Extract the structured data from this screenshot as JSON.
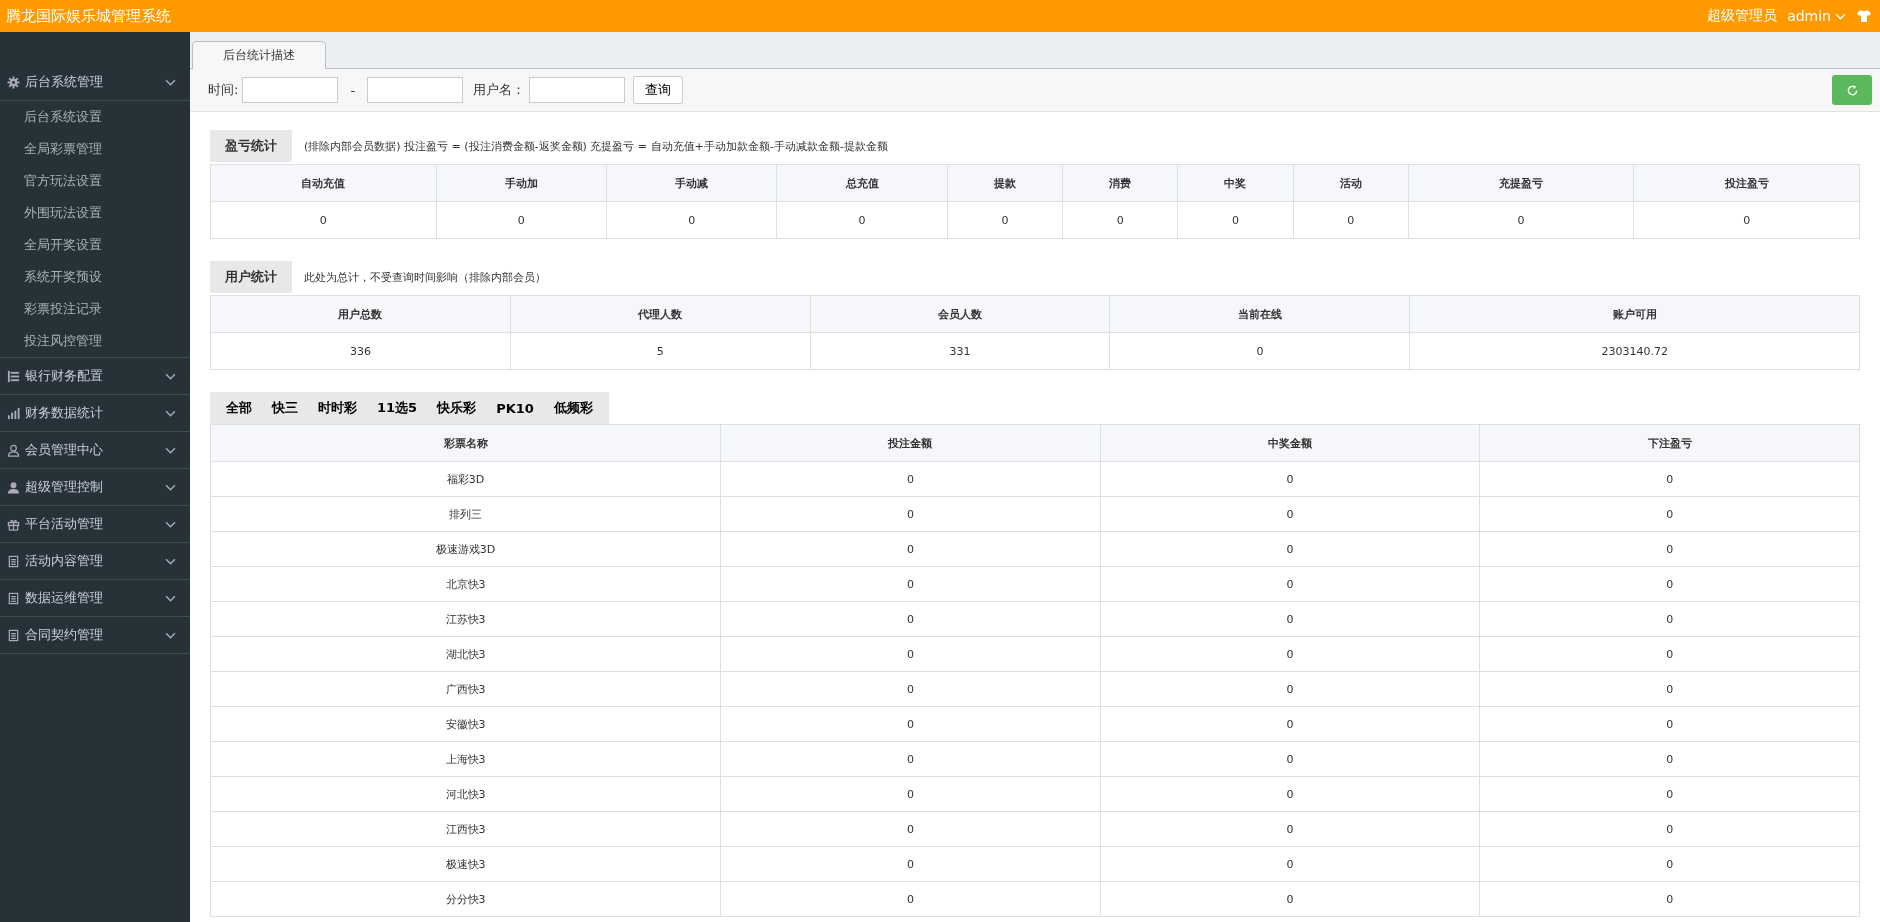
{
  "header": {
    "title": "腾龙国际娱乐城管理系统",
    "role": "超级管理员",
    "user": "admin"
  },
  "sidebar": {
    "groups": [
      {
        "label": "后台系统管理",
        "children": [
          "后台系统设置",
          "全局彩票管理",
          "官方玩法设置",
          "外围玩法设置",
          "全局开奖设置",
          "系统开奖预设",
          "彩票投注记录",
          "投注风控管理"
        ]
      },
      {
        "label": "银行财务配置"
      },
      {
        "label": "财务数据统计"
      },
      {
        "label": "会员管理中心"
      },
      {
        "label": "超级管理控制"
      },
      {
        "label": "平台活动管理"
      },
      {
        "label": "活动内容管理"
      },
      {
        "label": "数据运维管理"
      },
      {
        "label": "合同契约管理"
      }
    ]
  },
  "page_tabs": [
    {
      "label": "后台统计描述",
      "selected": true
    }
  ],
  "filter": {
    "time_label": "时间:",
    "separator": "-",
    "user_label": "用户名：",
    "query_button": "查询"
  },
  "profit_stats": {
    "title": "盈亏统计",
    "note": "(排除内部会员数据)  投注盈亏 = (投注消费金额-返奖金额)    充提盈亏 = 自动充值+手动加款金额-手动减款金额-提款金额",
    "columns": [
      "自动充值",
      "手动加",
      "手动减",
      "总充值",
      "提款",
      "消费",
      "中奖",
      "活动",
      "充提盈亏",
      "投注盈亏"
    ],
    "values": [
      "0",
      "0",
      "0",
      "0",
      "0",
      "0",
      "0",
      "0",
      "0",
      "0"
    ]
  },
  "user_stats": {
    "title": "用户统计",
    "note": "此处为总计，不受查询时间影响（排除内部会员）",
    "columns": [
      "用户总数",
      "代理人数",
      "会员人数",
      "当前在线",
      "账户可用"
    ],
    "values": [
      "336",
      "5",
      "331",
      "0",
      "2303140.72"
    ]
  },
  "lottery_tabs": [
    "全部",
    "快三",
    "时时彩",
    "11选5",
    "快乐彩",
    "PK10",
    "低频彩"
  ],
  "lottery_table": {
    "columns": [
      "彩票名称",
      "投注金额",
      "中奖金额",
      "下注盈亏"
    ],
    "rows": [
      [
        "福彩3D",
        "0",
        "0",
        "0"
      ],
      [
        "排列三",
        "0",
        "0",
        "0"
      ],
      [
        "极速游戏3D",
        "0",
        "0",
        "0"
      ],
      [
        "北京快3",
        "0",
        "0",
        "0"
      ],
      [
        "江苏快3",
        "0",
        "0",
        "0"
      ],
      [
        "湖北快3",
        "0",
        "0",
        "0"
      ],
      [
        "广西快3",
        "0",
        "0",
        "0"
      ],
      [
        "安徽快3",
        "0",
        "0",
        "0"
      ],
      [
        "上海快3",
        "0",
        "0",
        "0"
      ],
      [
        "河北快3",
        "0",
        "0",
        "0"
      ],
      [
        "江西快3",
        "0",
        "0",
        "0"
      ],
      [
        "极速快3",
        "0",
        "0",
        "0"
      ],
      [
        "分分快3",
        "0",
        "0",
        "0"
      ]
    ]
  }
}
